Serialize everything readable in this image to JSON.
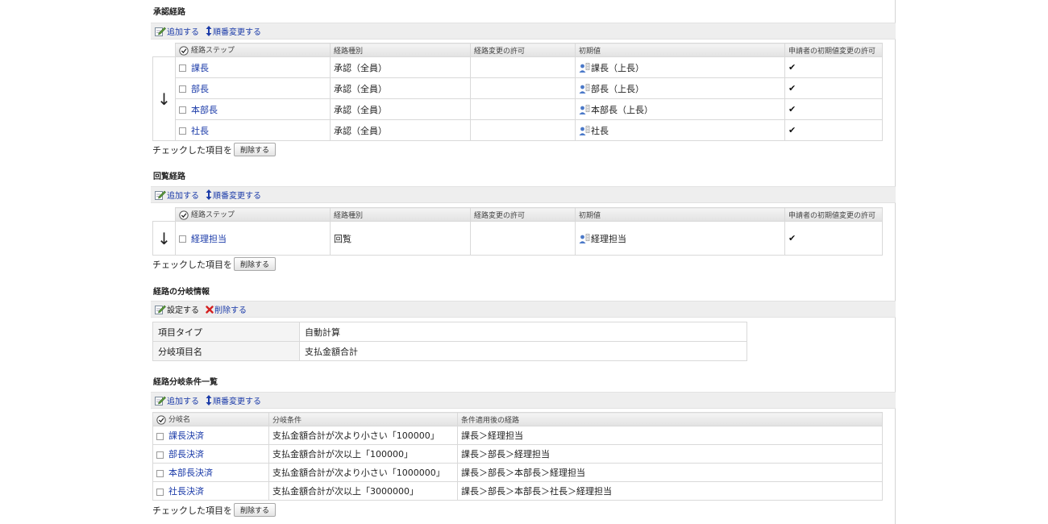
{
  "approval": {
    "title": "承認経路",
    "toolbar": {
      "add_label": "追加する",
      "order_label": "順番変更する"
    },
    "headers": [
      "経路ステップ",
      "経路種別",
      "経路変更の許可",
      "初期値",
      "申請者の初期値変更の許可"
    ],
    "rows": [
      {
        "step": "課長",
        "type": "承認（全員）",
        "perm": "",
        "initial": "課長（上長）",
        "applicant": "✔"
      },
      {
        "step": "部長",
        "type": "承認（全員）",
        "perm": "",
        "initial": "部長（上長）",
        "applicant": "✔"
      },
      {
        "step": "本部長",
        "type": "承認（全員）",
        "perm": "",
        "initial": "本部長（上長）",
        "applicant": "✔"
      },
      {
        "step": "社長",
        "type": "承認（全員）",
        "perm": "",
        "initial": "社長",
        "applicant": "✔"
      }
    ],
    "footer_label": "チェックした項目を",
    "delete_label": "削除する"
  },
  "circulation": {
    "title": "回覧経路",
    "toolbar": {
      "add_label": "追加する",
      "order_label": "順番変更する"
    },
    "headers": [
      "経路ステップ",
      "経路種別",
      "経路変更の許可",
      "初期値",
      "申請者の初期値変更の許可"
    ],
    "rows": [
      {
        "step": "経理担当",
        "type": "回覧",
        "perm": "",
        "initial": "経理担当",
        "applicant": "✔"
      }
    ],
    "footer_label": "チェックした項目を",
    "delete_label": "削除する"
  },
  "branch_info": {
    "title": "経路の分岐情報",
    "toolbar": {
      "set_label": "設定する",
      "delete_label": "削除する"
    },
    "rows": [
      {
        "key": "項目タイプ",
        "value": "自動計算"
      },
      {
        "key": "分岐項目名",
        "value": "支払金額合計"
      }
    ]
  },
  "branch_conditions": {
    "title": "経路分岐条件一覧",
    "toolbar": {
      "add_label": "追加する",
      "order_label": "順番変更する"
    },
    "headers": [
      "分岐名",
      "分岐条件",
      "条件適用後の経路"
    ],
    "rows": [
      {
        "name": "課長決済",
        "condition": "支払金額合計が次より小さい「100000」",
        "route": "課長＞経理担当"
      },
      {
        "name": "部長決済",
        "condition": "支払金額合計が次以上「100000」",
        "route": "課長＞部長＞経理担当"
      },
      {
        "name": "本部長決済",
        "condition": "支払金額合計が次より小さい「1000000」",
        "route": "課長＞部長＞本部長＞経理担当"
      },
      {
        "name": "社長決済",
        "condition": "支払金額合計が次以上「3000000」",
        "route": "課長＞部長＞本部長＞社長＞経理担当"
      }
    ],
    "footer_label": "チェックした項目を",
    "delete_label": "削除する"
  },
  "icons": [
    "edit-icon",
    "reorder-icon",
    "delete-x-icon",
    "check-all-icon",
    "user-icon",
    "down-arrow-icon"
  ],
  "colors": {
    "link": "#1a3aa8",
    "toolbar_bg": "#eeeeee",
    "header_bg": "#e6e6e6",
    "delete_x": "#d42020"
  }
}
